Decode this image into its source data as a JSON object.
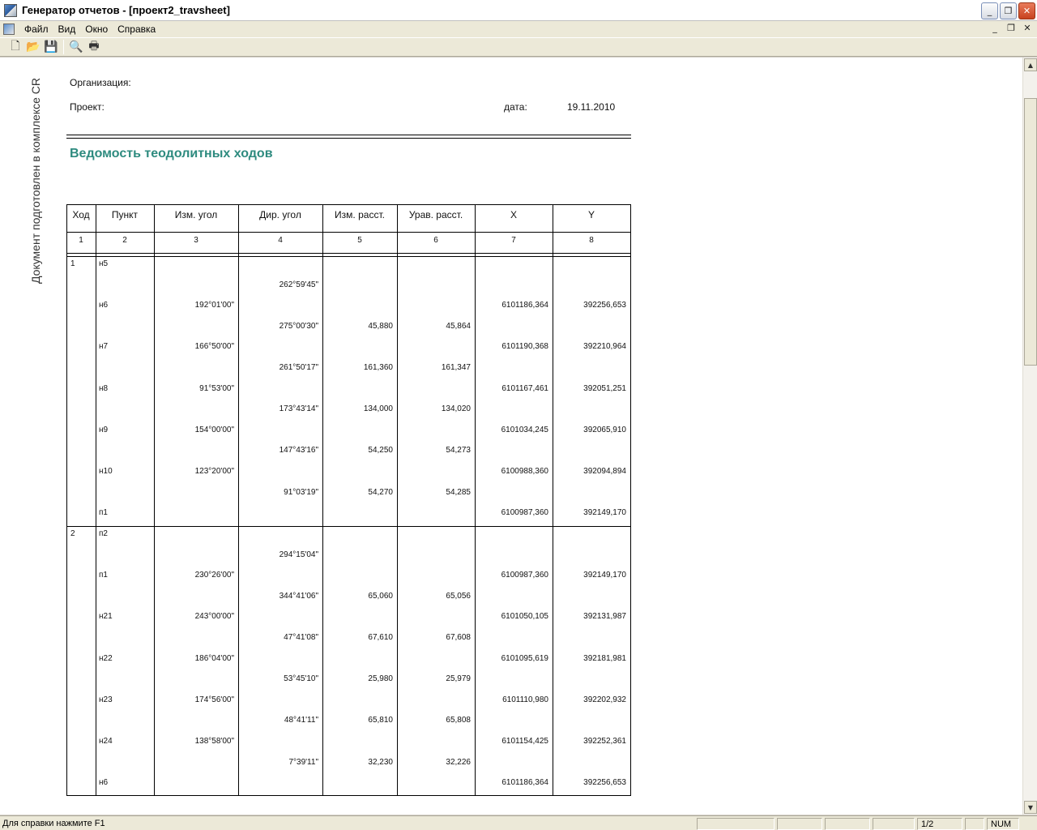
{
  "window": {
    "title": "Генератор отчетов - [проект2_travsheet]",
    "buttons": {
      "minimize": "_",
      "restore": "❐",
      "close": "✕"
    }
  },
  "menu": {
    "items": [
      "Файл",
      "Вид",
      "Окно",
      "Справка"
    ],
    "mdi": {
      "minimize": "_",
      "restore": "❐",
      "close": "✕"
    }
  },
  "toolbar": {
    "icons": [
      "new-document-icon",
      "open-folder-icon",
      "save-icon",
      "print-preview-icon",
      "print-icon"
    ],
    "glyphs": [
      "🗋",
      "📂",
      "💾",
      "🔍",
      "🖶"
    ]
  },
  "document": {
    "side_text": "Документ подготовлен в комплексе CR",
    "org_label": "Организация:",
    "project_label": "Проект:",
    "date_label": "дата:",
    "date_value": "19.11.2010",
    "title": "Ведомость теодолитных ходов",
    "title_color": "#2e8b7f",
    "table": {
      "headers": [
        "Ход",
        "Пункт",
        "Изм. угол",
        "Дир. угол",
        "Изм. расст.",
        "Урав. расст.",
        "X",
        "Y"
      ],
      "numbers": [
        "1",
        "2",
        "3",
        "4",
        "5",
        "6",
        "7",
        "8"
      ],
      "traverses": [
        {
          "id": "1",
          "rows": [
            {
              "point": "н5",
              "angle": "",
              "dir": "",
              "dist": "",
              "adj": "",
              "x": "",
              "y": ""
            },
            {
              "point": "",
              "angle": "",
              "dir": "262°59'45\"",
              "dist": "",
              "adj": "",
              "x": "",
              "y": ""
            },
            {
              "point": "н6",
              "angle": "192°01'00\"",
              "dir": "",
              "dist": "",
              "adj": "",
              "x": "6101186,364",
              "y": "392256,653"
            },
            {
              "point": "",
              "angle": "",
              "dir": "275°00'30\"",
              "dist": "45,880",
              "adj": "45,864",
              "x": "",
              "y": ""
            },
            {
              "point": "н7",
              "angle": "166°50'00\"",
              "dir": "",
              "dist": "",
              "adj": "",
              "x": "6101190,368",
              "y": "392210,964"
            },
            {
              "point": "",
              "angle": "",
              "dir": "261°50'17\"",
              "dist": "161,360",
              "adj": "161,347",
              "x": "",
              "y": ""
            },
            {
              "point": "н8",
              "angle": "91°53'00\"",
              "dir": "",
              "dist": "",
              "adj": "",
              "x": "6101167,461",
              "y": "392051,251"
            },
            {
              "point": "",
              "angle": "",
              "dir": "173°43'14\"",
              "dist": "134,000",
              "adj": "134,020",
              "x": "",
              "y": ""
            },
            {
              "point": "н9",
              "angle": "154°00'00\"",
              "dir": "",
              "dist": "",
              "adj": "",
              "x": "6101034,245",
              "y": "392065,910"
            },
            {
              "point": "",
              "angle": "",
              "dir": "147°43'16\"",
              "dist": "54,250",
              "adj": "54,273",
              "x": "",
              "y": ""
            },
            {
              "point": "н10",
              "angle": "123°20'00\"",
              "dir": "",
              "dist": "",
              "adj": "",
              "x": "6100988,360",
              "y": "392094,894"
            },
            {
              "point": "",
              "angle": "",
              "dir": "91°03'19\"",
              "dist": "54,270",
              "adj": "54,285",
              "x": "",
              "y": ""
            },
            {
              "point": "п1",
              "angle": "",
              "dir": "",
              "dist": "",
              "adj": "",
              "x": "6100987,360",
              "y": "392149,170"
            }
          ]
        },
        {
          "id": "2",
          "rows": [
            {
              "point": "п2",
              "angle": "",
              "dir": "",
              "dist": "",
              "adj": "",
              "x": "",
              "y": ""
            },
            {
              "point": "",
              "angle": "",
              "dir": "294°15'04\"",
              "dist": "",
              "adj": "",
              "x": "",
              "y": ""
            },
            {
              "point": "п1",
              "angle": "230°26'00\"",
              "dir": "",
              "dist": "",
              "adj": "",
              "x": "6100987,360",
              "y": "392149,170"
            },
            {
              "point": "",
              "angle": "",
              "dir": "344°41'06\"",
              "dist": "65,060",
              "adj": "65,056",
              "x": "",
              "y": ""
            },
            {
              "point": "н21",
              "angle": "243°00'00\"",
              "dir": "",
              "dist": "",
              "adj": "",
              "x": "6101050,105",
              "y": "392131,987"
            },
            {
              "point": "",
              "angle": "",
              "dir": "47°41'08\"",
              "dist": "67,610",
              "adj": "67,608",
              "x": "",
              "y": ""
            },
            {
              "point": "н22",
              "angle": "186°04'00\"",
              "dir": "",
              "dist": "",
              "adj": "",
              "x": "6101095,619",
              "y": "392181,981"
            },
            {
              "point": "",
              "angle": "",
              "dir": "53°45'10\"",
              "dist": "25,980",
              "adj": "25,979",
              "x": "",
              "y": ""
            },
            {
              "point": "н23",
              "angle": "174°56'00\"",
              "dir": "",
              "dist": "",
              "adj": "",
              "x": "6101110,980",
              "y": "392202,932"
            },
            {
              "point": "",
              "angle": "",
              "dir": "48°41'11\"",
              "dist": "65,810",
              "adj": "65,808",
              "x": "",
              "y": ""
            },
            {
              "point": "н24",
              "angle": "138°58'00\"",
              "dir": "",
              "dist": "",
              "adj": "",
              "x": "6101154,425",
              "y": "392252,361"
            },
            {
              "point": "",
              "angle": "",
              "dir": "7°39'11\"",
              "dist": "32,230",
              "adj": "32,226",
              "x": "",
              "y": ""
            },
            {
              "point": "н6",
              "angle": "",
              "dir": "",
              "dist": "",
              "adj": "",
              "x": "6101186,364",
              "y": "392256,653"
            }
          ]
        }
      ]
    }
  },
  "statusbar": {
    "text": "Для справки нажмите F1",
    "page": "1/2",
    "num": "NUM"
  }
}
